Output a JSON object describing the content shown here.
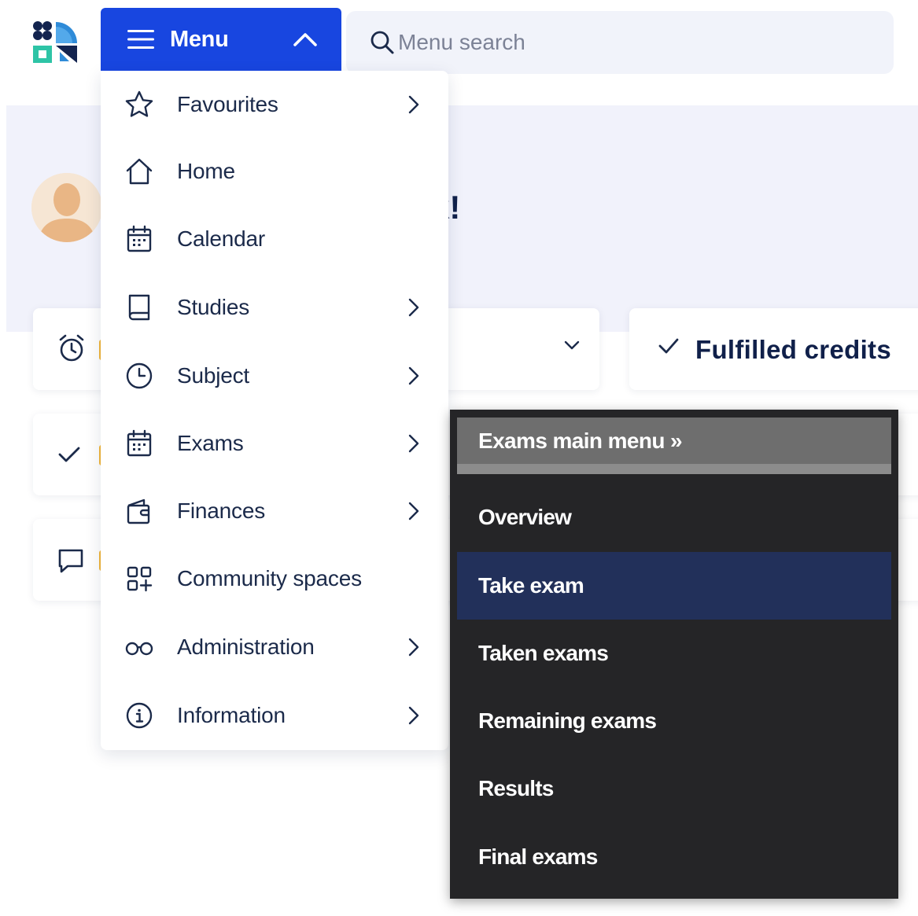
{
  "header": {
    "menu_label": "Menu",
    "search_placeholder": "Menu search"
  },
  "page": {
    "greeting_partial": "k!",
    "fulfilled_credits_label": "Fulfilled credits"
  },
  "menu": {
    "items": [
      {
        "label": "Favourites",
        "icon": "star-icon",
        "has_submenu": true
      },
      {
        "label": "Home",
        "icon": "home-icon",
        "has_submenu": false
      },
      {
        "label": "Calendar",
        "icon": "calendar-icon",
        "has_submenu": false
      },
      {
        "label": "Studies",
        "icon": "book-icon",
        "has_submenu": true
      },
      {
        "label": "Subject",
        "icon": "clock-icon",
        "has_submenu": true
      },
      {
        "label": "Exams",
        "icon": "calendar-icon",
        "has_submenu": true
      },
      {
        "label": "Finances",
        "icon": "wallet-icon",
        "has_submenu": true
      },
      {
        "label": "Community spaces",
        "icon": "grid-plus-icon",
        "has_submenu": false
      },
      {
        "label": "Administration",
        "icon": "glasses-icon",
        "has_submenu": true
      },
      {
        "label": "Information",
        "icon": "info-icon",
        "has_submenu": true
      }
    ]
  },
  "exams_submenu": {
    "header": "Exams main menu »",
    "items": [
      {
        "label": "Overview",
        "active": false
      },
      {
        "label": "Take exam",
        "active": true
      },
      {
        "label": "Taken exams",
        "active": false
      },
      {
        "label": "Remaining exams",
        "active": false
      },
      {
        "label": "Results",
        "active": false
      },
      {
        "label": "Final exams",
        "active": false
      }
    ]
  },
  "colors": {
    "primary_blue": "#1846e0",
    "submenu_bg": "#252527",
    "submenu_active": "#22305a",
    "text_navy": "#1b2a4a",
    "accent_yellow": "#f3b73a"
  }
}
